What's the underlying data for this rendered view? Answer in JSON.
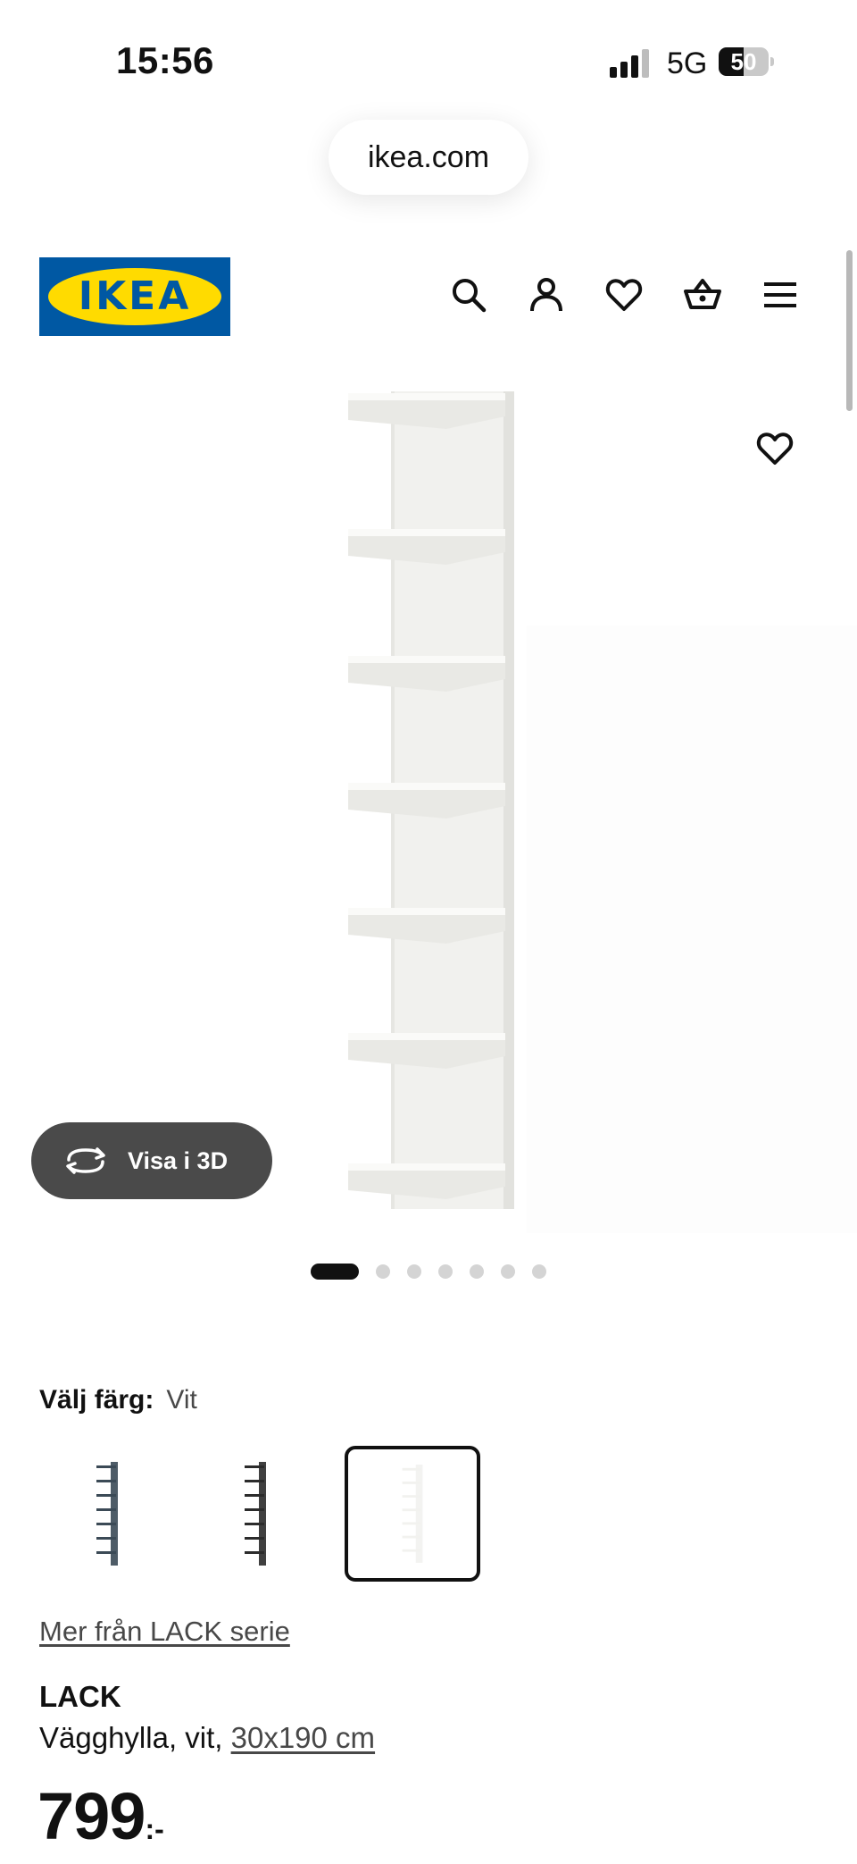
{
  "status_bar": {
    "time": "15:56",
    "network": "5G",
    "battery_level": "50",
    "battery_fraction": 0.5
  },
  "browser": {
    "url": "ikea.com"
  },
  "header": {
    "logo_text": "IKEA",
    "icons": [
      "search-icon",
      "account-icon",
      "heart-icon",
      "basket-icon",
      "menu-icon"
    ],
    "brand_colors": {
      "blue": "#0058a3",
      "yellow": "#ffdb00"
    }
  },
  "gallery": {
    "view_3d_label": "Visa i 3D",
    "image_count": 7,
    "active_index": 0
  },
  "color_selector": {
    "label": "Välj färg:",
    "value": "Vit",
    "options": [
      {
        "name": "swatch-dark-blue-gray",
        "color": "#3b4a56"
      },
      {
        "name": "swatch-black-brown",
        "color": "#2b2b2b"
      },
      {
        "name": "swatch-white",
        "color": "#f2f2ef",
        "selected": true
      }
    ]
  },
  "product": {
    "series_link": "Mer från LACK serie",
    "name": "LACK",
    "desc_prefix": "Vägghylla, vit, ",
    "desc_dimension": "30x190 cm",
    "price_integer": "799",
    "price_suffix": ":-"
  }
}
